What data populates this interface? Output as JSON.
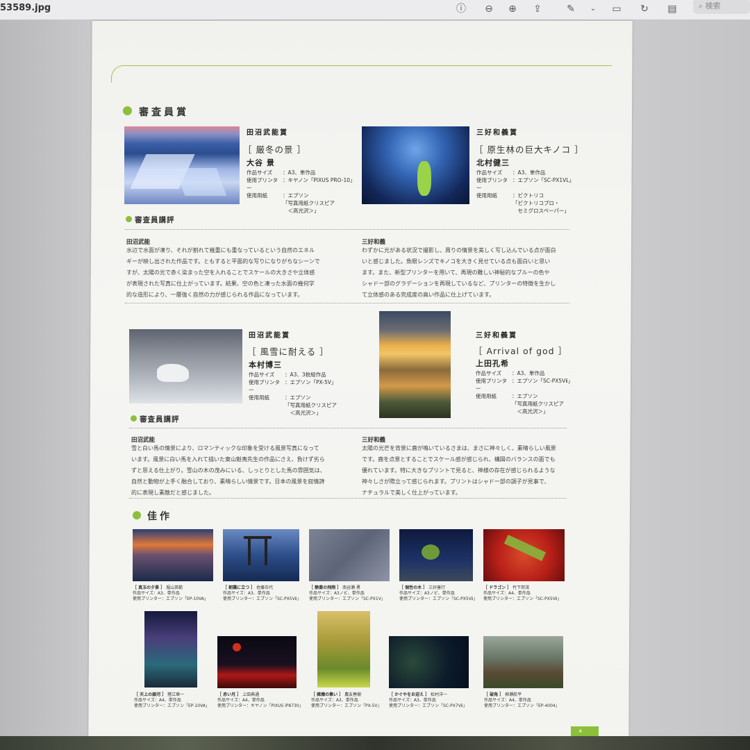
{
  "window": {
    "file_name": "53589.jpg",
    "search_placeholder": "検索"
  },
  "toolbar": {
    "icons": [
      "info-icon",
      "zoom-out-icon",
      "zoom-in-icon",
      "share-icon",
      "markup-pen-icon",
      "chevron-down-icon",
      "crop-icon",
      "rotate-icon",
      "form-icon",
      "search-icon"
    ]
  },
  "colors": {
    "accent": "#8cbf3a",
    "line": "#a8c44a"
  },
  "section_judges": {
    "title": "審査員賞"
  },
  "awards": [
    {
      "award": "田沼武能賞",
      "work": "［ 厳冬の景 ］",
      "author": "大谷 景",
      "specs": [
        [
          "作品サイズ",
          "：A3、単作品"
        ],
        [
          "使用プリンター",
          "：キヤノン「PIXUS PRO-10」"
        ],
        [
          "使用用紙",
          "：エプソン"
        ],
        [
          "",
          "「写真用紙クリスピア"
        ],
        [
          "",
          "　＜高光沢＞」"
        ]
      ]
    },
    {
      "award": "三好和義賞",
      "work": "［ 原生林の巨大キノコ ］",
      "author": "北村健三",
      "specs": [
        [
          "作品サイズ",
          "：A3、単作品"
        ],
        [
          "使用プリンター",
          "：エプソン「SC-PX1VL」"
        ],
        [
          "使用用紙",
          "：ピクトリコ"
        ],
        [
          "",
          "「ピクトリコプロ・"
        ],
        [
          "",
          "　セミグロスペーパー」"
        ]
      ]
    },
    {
      "award": "田沼武能賞",
      "work": "［ 風雪に耐える ］",
      "author": "本村博三",
      "specs": [
        [
          "作品サイズ",
          "：A3、3枚組作品"
        ],
        [
          "使用プリンター",
          "：エプソン「PX-5V」"
        ],
        [
          "使用用紙",
          "：エプソン"
        ],
        [
          "",
          "「写真用紙クリスピア"
        ],
        [
          "",
          "　＜高光沢＞」"
        ]
      ]
    },
    {
      "award": "三好和義賞",
      "work": "［ Arrival of god ］",
      "author": "上田孔希",
      "specs": [
        [
          "作品サイズ",
          "：A3、単作品"
        ],
        [
          "使用プリンター",
          "：エプソン「SC-PX5Vⅱ」"
        ],
        [
          "使用用紙",
          "：エプソン"
        ],
        [
          "",
          "「写真用紙クリスピア"
        ],
        [
          "",
          "　＜高光沢＞」"
        ]
      ]
    }
  ],
  "review_label": "審査員講評",
  "reviews": [
    {
      "judge": "田沼武能",
      "lines": [
        "水辺で水面が凍り、それが割れて幾重にも重なっているという自然のエネル",
        "ギーが映し出された作品です。ともすると平面的な写りになりがちなシーンで",
        "すが、太陽の光で赤く染まった空を入れることでスケールの大きさや立体感",
        "が表現された写真に仕上がっています。結果、空の色と凍った水面の幾何学",
        "的な造形により、一層強く自然の力が感じられる作品になっています。"
      ]
    },
    {
      "judge": "三好和義",
      "lines": [
        "わずかに光がある状況で撮影し、周りの情景を美しく写し込んでいる点が面白",
        "いと感じました。魚眼レンズでキノコを大きく見せている点も面白いと思い",
        "ます。また、新型プリンターを用いて、再現の難しい神秘的なブルーの色や",
        "シャドー部のグラデーションを再現しているなど、プリンターの特徴を生かし",
        "て立体感のある完成度の高い作品に仕上げています。"
      ]
    },
    {
      "judge": "田沼武能",
      "lines": [
        "雪と白い馬の情景により、ロマンティックな印象を受ける風景写真になって",
        "います。風景に白い馬を入れて描いた東山魁夷先生の作品にさえ、負けず劣ら",
        "ずと思える仕上がり。雪山の木の茂みにいる、しっとりとした馬の雰囲気は、",
        "自然と動物が上手く融合しており、素晴らしい情景です。日本の風景を叙情詩",
        "的に表現し素敵だと感じました。"
      ]
    },
    {
      "judge": "三好和義",
      "lines": [
        "太陽の光芒を背景に鹿が鳴いているさまは、まさに神々しく、素晴らしい風景",
        "です。鹿を点景とすることでスケール感が感じられ、構図のバランスの面でも",
        "優れています。特に大きなプリントで見ると、神様の存在が感じられるような",
        "神々しさが際立って感じられます。プリントはシャドー部の調子が見事で、",
        "ナチュラルで美しく仕上がっています。"
      ]
    }
  ],
  "section_good": {
    "title": "佳作"
  },
  "good_works": [
    {
      "title": "［ 真玉の夕景 ］",
      "author": "堀山英範",
      "size": "作品サイズ：A3、単作品",
      "printer": "使用プリンター：エプソン「EP-10VA」"
    },
    {
      "title": "［ 朝靄に立つ ］",
      "author": "佐藤衣代",
      "size": "作品サイズ：A3、単作品",
      "printer": "使用プリンター：エプソン「SC-PX5Vⅱ」"
    },
    {
      "title": "［ 静粛の飛翔 ］",
      "author": "南谷瀬 勇",
      "size": "作品サイズ：A3ノビ、単作品",
      "printer": "使用プリンター：エプソン「SC-PX1V」"
    },
    {
      "title": "［ 個性の木 ］",
      "author": "三好善行",
      "size": "作品サイズ：A3ノビ、単作品",
      "printer": "使用プリンター：エプソン「SC-PX5Vⅱ」"
    },
    {
      "title": "［ ドラゴン ］",
      "author": "竹下邦茂",
      "size": "作品サイズ：A4、単作品",
      "printer": "使用プリンター：エプソン「SC-PX5Vⅱ」"
    },
    {
      "title": "［ 天上の銀河 ］",
      "author": "猪江華一",
      "size": "作品サイズ：A4、単作品",
      "printer": "使用プリンター：エプソン「EP-10VA」"
    },
    {
      "title": "［ 赤い月 ］",
      "author": "上田典通",
      "size": "作品サイズ：A4、単作品",
      "printer": "使用プリンター：キヤノン「PIXUS iP8730」"
    },
    {
      "title": "［ 雑魔の集い ］",
      "author": "農友春樹",
      "size": "作品サイズ：A3、単作品",
      "printer": "使用プリンター：エプソン「PX-5V」"
    },
    {
      "title": "［ かぐやをお迎え ］",
      "author": "松村洋一",
      "size": "作品サイズ：A3、単作品",
      "printer": "使用プリンター：エプソン「SC-PX7Vⅱ」"
    },
    {
      "title": "［ 破角 ］",
      "author": "柳瀬航平",
      "size": "作品サイズ：A4、単作品",
      "printer": "使用プリンター：エプソン「EP-4004」"
    }
  ],
  "page_number": "4"
}
